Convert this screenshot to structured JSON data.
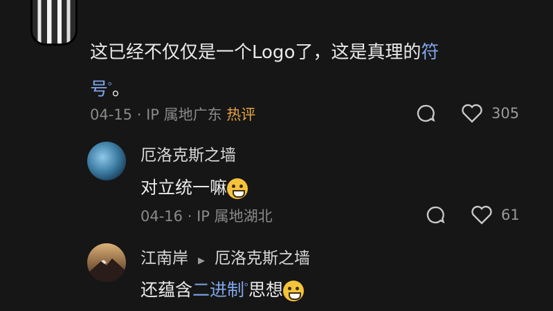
{
  "main_comment": {
    "text_part1": "这已经不仅仅是一个Logo了，这是真理的",
    "link_part1": "符",
    "link_part2": "号",
    "text_end": "。",
    "date": "04-15",
    "sep": " · ",
    "location": "IP 属地广东",
    "hot_label": "热评",
    "likes": "305"
  },
  "replies": [
    {
      "name": "厄洛克斯之墙",
      "text": "对立统一嘛",
      "date": "04-16",
      "sep": " · ",
      "location": "IP 属地湖北",
      "likes": "61"
    },
    {
      "name": "江南岸",
      "reply_to": "厄洛克斯之墙",
      "text_before": "还蕴含",
      "link": "二进制",
      "text_after": "思想"
    }
  ],
  "colors": {
    "background": "#161616",
    "link": "#7fa6e8",
    "hot": "#e4a341",
    "meta": "#8a8a8a"
  },
  "icons": [
    "comment-icon",
    "heart-icon",
    "search-icon",
    "play-arrow-icon"
  ]
}
